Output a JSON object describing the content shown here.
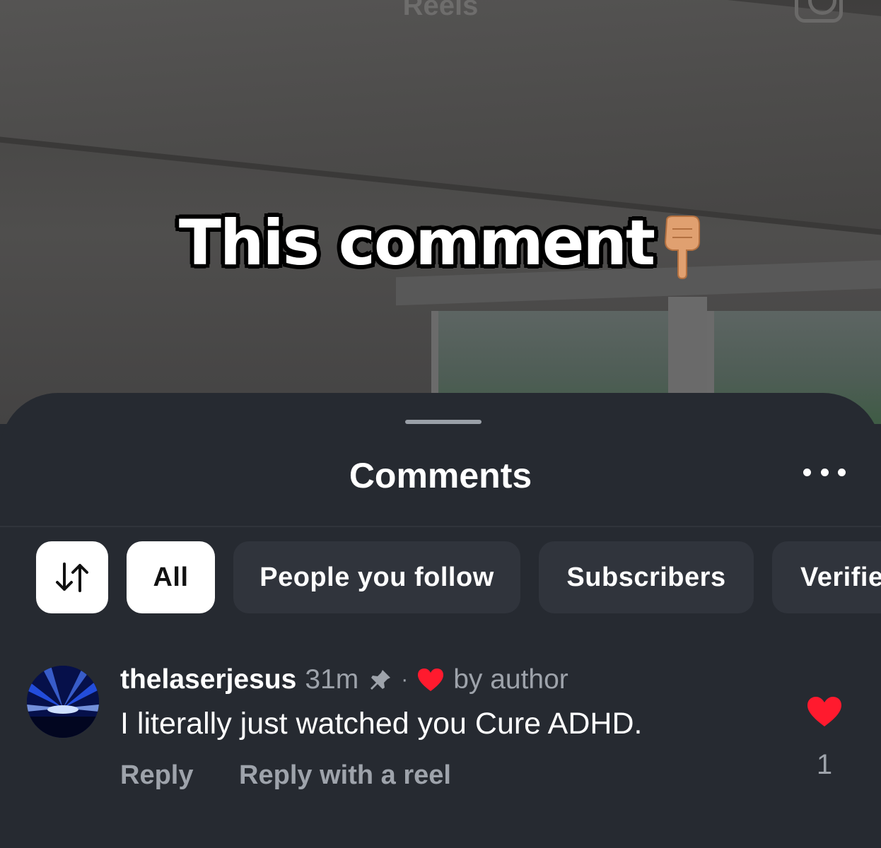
{
  "reel": {
    "header_title": "Reels",
    "overlay_caption": "This comment",
    "caption_emoji_icon": "backhand-index-pointing-down-icon"
  },
  "sheet": {
    "title": "Comments",
    "more_icon": "more-horizontal-icon"
  },
  "filters": {
    "sort_icon": "sort-arrows-icon",
    "chips": [
      {
        "label": "All",
        "active": true
      },
      {
        "label": "People you follow",
        "active": false
      },
      {
        "label": "Subscribers",
        "active": false
      },
      {
        "label": "Verifie",
        "active": false
      }
    ]
  },
  "comments": [
    {
      "username": "thelaserjesus",
      "time": "31m",
      "pinned": true,
      "separator": "·",
      "liked_by_author": "by author",
      "text": "I literally just watched you Cure ADHD.",
      "actions": {
        "reply": "Reply",
        "reply_with_reel": "Reply with a reel"
      },
      "like_count": "1",
      "liked": true
    }
  ],
  "colors": {
    "sheet_background": "#262a31",
    "chip_background": "#30343c",
    "active_chip": "#ffffff",
    "muted_text": "#9ea3ab",
    "heart": "#ff1a2e"
  }
}
